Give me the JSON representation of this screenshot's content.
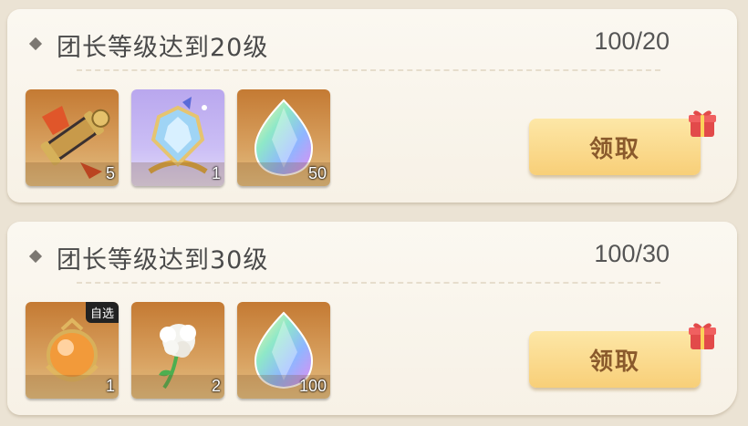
{
  "tasks": [
    {
      "title": "团长等级达到20级",
      "progress": "100/20",
      "claim_label": "领取",
      "rewards": [
        {
          "icon": "scroll-icon",
          "count": "5",
          "bg": "orange"
        },
        {
          "icon": "crystal-brooch-icon",
          "count": "1",
          "bg": "purple"
        },
        {
          "icon": "rainbow-gem-icon",
          "count": "50",
          "bg": "orange"
        }
      ]
    },
    {
      "title": "团长等级达到30级",
      "progress": "100/30",
      "claim_label": "领取",
      "rewards": [
        {
          "icon": "orange-orb-icon",
          "count": "1",
          "bg": "orange",
          "tag": "自选"
        },
        {
          "icon": "white-flower-icon",
          "count": "2",
          "bg": "orange"
        },
        {
          "icon": "rainbow-gem-icon",
          "count": "100",
          "bg": "orange"
        }
      ]
    }
  ],
  "colors": {
    "button_top": "#fde7a7",
    "button_bottom": "#f8cf78",
    "button_text": "#8a5a2c",
    "gift_red": "#e24a4a"
  }
}
